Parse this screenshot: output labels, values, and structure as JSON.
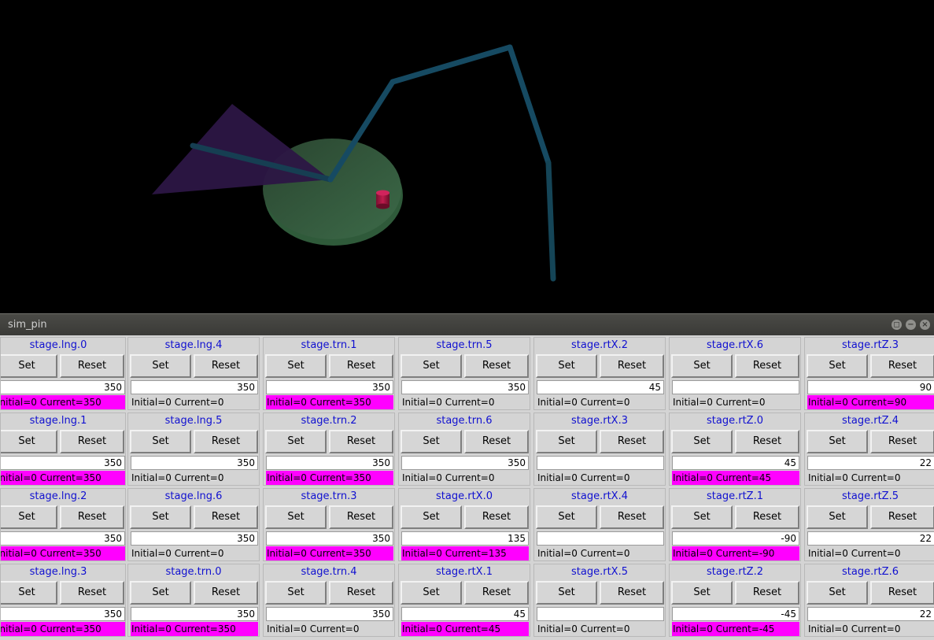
{
  "window": {
    "title": "sim_pin"
  },
  "colors": {
    "changed": "#ff00ff",
    "pin_name": "#1010d0"
  },
  "buttons": {
    "set_label": "Set",
    "reset_label": "Reset"
  },
  "pins": [
    {
      "name": "stage.lng.0",
      "value": "350",
      "status": "Initial=0 Current=350",
      "changed": true
    },
    {
      "name": "stage.lng.1",
      "value": "350",
      "status": "Initial=0 Current=350",
      "changed": true
    },
    {
      "name": "stage.lng.2",
      "value": "350",
      "status": "Initial=0 Current=350",
      "changed": true
    },
    {
      "name": "stage.lng.3",
      "value": "350",
      "status": "Initial=0 Current=350",
      "changed": true
    },
    {
      "name": "stage.lng.4",
      "value": "350",
      "status": "Initial=0 Current=0",
      "changed": false
    },
    {
      "name": "stage.lng.5",
      "value": "350",
      "status": "Initial=0 Current=0",
      "changed": false
    },
    {
      "name": "stage.lng.6",
      "value": "350",
      "status": "Initial=0 Current=0",
      "changed": false
    },
    {
      "name": "stage.trn.0",
      "value": "350",
      "status": "Initial=0 Current=350",
      "changed": true
    },
    {
      "name": "stage.trn.1",
      "value": "350",
      "status": "Initial=0 Current=350",
      "changed": true
    },
    {
      "name": "stage.trn.2",
      "value": "350",
      "status": "Initial=0 Current=350",
      "changed": true
    },
    {
      "name": "stage.trn.3",
      "value": "350",
      "status": "Initial=0 Current=350",
      "changed": true
    },
    {
      "name": "stage.trn.4",
      "value": "350",
      "status": "Initial=0 Current=0",
      "changed": false
    },
    {
      "name": "stage.trn.5",
      "value": "350",
      "status": "Initial=0 Current=0",
      "changed": false
    },
    {
      "name": "stage.trn.6",
      "value": "350",
      "status": "Initial=0 Current=0",
      "changed": false
    },
    {
      "name": "stage.rtX.0",
      "value": "135",
      "status": "Initial=0 Current=135",
      "changed": true
    },
    {
      "name": "stage.rtX.1",
      "value": "45",
      "status": "Initial=0 Current=45",
      "changed": true
    },
    {
      "name": "stage.rtX.2",
      "value": "45",
      "status": "Initial=0 Current=0",
      "changed": false
    },
    {
      "name": "stage.rtX.3",
      "value": "",
      "status": "Initial=0 Current=0",
      "changed": false
    },
    {
      "name": "stage.rtX.4",
      "value": "",
      "status": "Initial=0 Current=0",
      "changed": false
    },
    {
      "name": "stage.rtX.5",
      "value": "",
      "status": "Initial=0 Current=0",
      "changed": false
    },
    {
      "name": "stage.rtX.6",
      "value": "",
      "status": "Initial=0 Current=0",
      "changed": false
    },
    {
      "name": "stage.rtZ.0",
      "value": "45",
      "status": "Initial=0 Current=45",
      "changed": true
    },
    {
      "name": "stage.rtZ.1",
      "value": "-90",
      "status": "Initial=0 Current=-90",
      "changed": true
    },
    {
      "name": "stage.rtZ.2",
      "value": "-45",
      "status": "Initial=0 Current=-45",
      "changed": true
    },
    {
      "name": "stage.rtZ.3",
      "value": "90",
      "status": "Initial=0 Current=90",
      "changed": true
    },
    {
      "name": "stage.rtZ.4",
      "value": "22",
      "status": "Initial=0 Current=0",
      "changed": false
    },
    {
      "name": "stage.rtZ.5",
      "value": "22",
      "status": "Initial=0 Current=0",
      "changed": false
    },
    {
      "name": "stage.rtZ.6",
      "value": "22",
      "status": "Initial=0 Current=0",
      "changed": false
    }
  ]
}
